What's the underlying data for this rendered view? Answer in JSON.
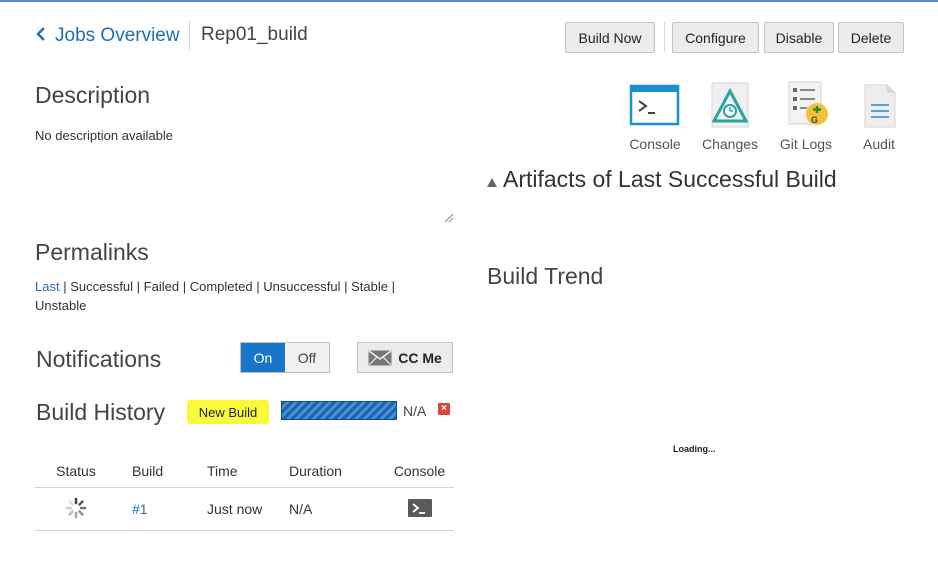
{
  "header": {
    "back_label": "Jobs Overview",
    "job_name": "Rep01_build"
  },
  "toolbar": {
    "build_now": "Build Now",
    "configure": "Configure",
    "disable": "Disable",
    "delete": "Delete"
  },
  "actions": [
    {
      "label": "Console",
      "icon": "console-icon"
    },
    {
      "label": "Changes",
      "icon": "changes-icon"
    },
    {
      "label": "Git Logs",
      "icon": "git-logs-icon"
    },
    {
      "label": "Audit",
      "icon": "audit-icon"
    }
  ],
  "description": {
    "heading": "Description",
    "text": "No description available"
  },
  "permalinks": {
    "heading": "Permalinks",
    "links": [
      "Last",
      "Successful",
      "Failed",
      "Completed",
      "Unsuccessful",
      "Stable",
      "Unstable"
    ],
    "separator": " | "
  },
  "notifications": {
    "heading": "Notifications",
    "on_label": "On",
    "off_label": "Off",
    "selected": "On",
    "ccme_label": "CC Me"
  },
  "build_history": {
    "heading": "Build History",
    "new_build_label": "New Build",
    "progress_value": "N/A",
    "columns": [
      "Status",
      "Build",
      "Time",
      "Duration",
      "Console"
    ],
    "rows": [
      {
        "build": "#1",
        "time": "Just now",
        "duration": "N/A"
      }
    ]
  },
  "right": {
    "artifacts_heading": "Artifacts of Last Successful Build",
    "build_trend_heading": "Build Trend",
    "loading_text": "Loading..."
  },
  "colors": {
    "accent": "#1975c9",
    "link": "#1f6fb5",
    "highlight": "#fafa3a"
  }
}
